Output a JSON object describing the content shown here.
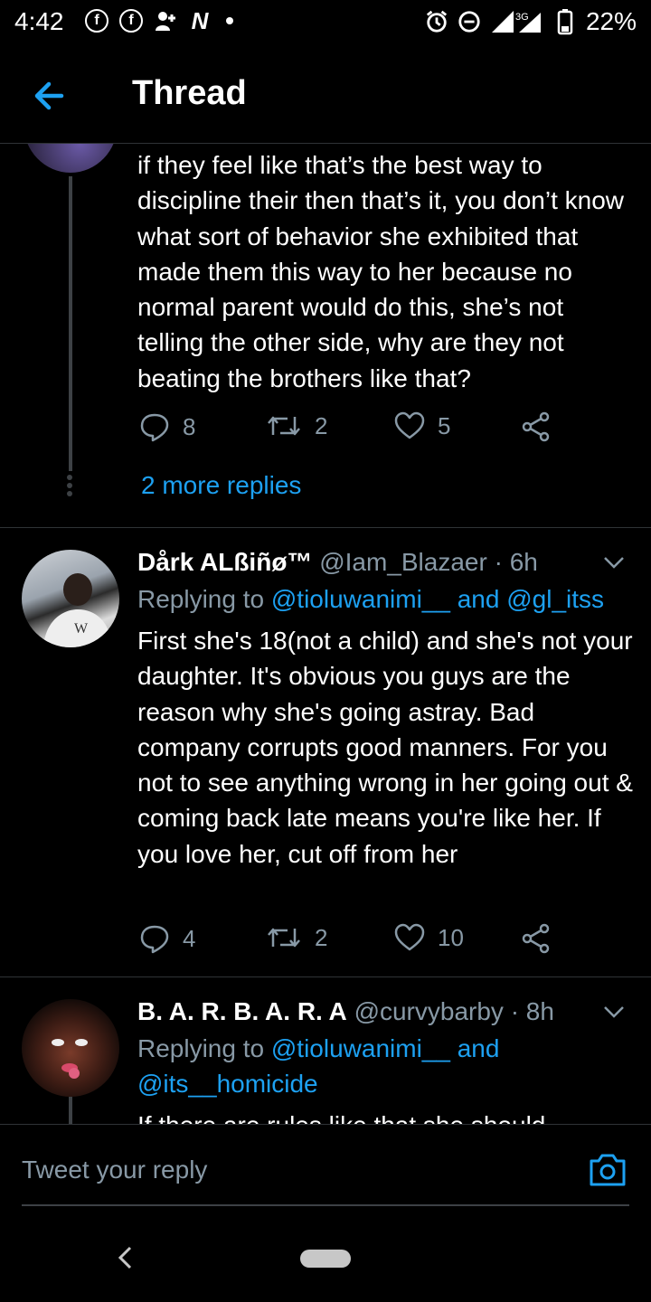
{
  "status_bar": {
    "time": "4:42",
    "battery": "22%",
    "network": "3G"
  },
  "header": {
    "title": "Thread"
  },
  "tweets": [
    {
      "text": "if they feel like that’s the best way to discipline their then that’s it, you don’t know what sort of behavior she exhibited that made them this way to her because no normal parent would do this, she’s not telling the other side, why are they not beating the brothers like that?",
      "replies": "8",
      "retweets": "2",
      "likes": "5",
      "more_replies": "2 more replies"
    },
    {
      "name": "Dårk ALßiñø™",
      "handle": "@Iam_Blazaer · 6h",
      "replying_prefix": "Replying to",
      "replying_to_1": "@tioluwanimi__",
      "replying_and": "and",
      "replying_to_2": "@gl_itss",
      "text": "First she's 18(not a child) and she's not your daughter. It's obvious you guys are the reason why she's going astray. Bad company corrupts good manners. For you not to see anything wrong in her going out & coming back late means you're like her. If you love her, cut off from her",
      "replies": "4",
      "retweets": "2",
      "likes": "10"
    },
    {
      "name": "B. A. R. B. A. R. A",
      "handle": "@curvybarby · 8h",
      "replying_prefix": "Replying to",
      "replying_to_1": "@tioluwanimi__",
      "replying_and": "and",
      "replying_to_2": "@its__homicide",
      "text_partial": "If there are rules like that she should"
    }
  ],
  "reply_bar": {
    "placeholder": "Tweet your reply"
  },
  "icons": {
    "back": "back-arrow-icon",
    "reply": "reply-icon",
    "retweet": "retweet-icon",
    "like": "heart-icon",
    "share": "share-icon",
    "camera": "camera-icon"
  },
  "colors": {
    "accent": "#1da1f2",
    "muted": "#8899a6",
    "background": "#000000"
  }
}
